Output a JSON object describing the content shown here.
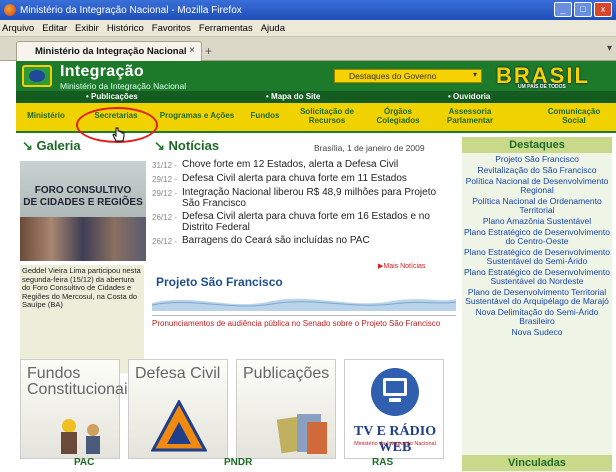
{
  "window": {
    "title": "Ministério da Integração Nacional - Mozilla Firefox"
  },
  "menu": [
    "Arquivo",
    "Editar",
    "Exibir",
    "Histórico",
    "Favoritos",
    "Ferramentas",
    "Ajuda"
  ],
  "tab": {
    "label": "Ministério da Integração Nacional",
    "close": "×",
    "new": "+"
  },
  "header": {
    "brand": "Integração",
    "subbrand": "Ministério da Integração Nacional",
    "dropdown": "Destaques do Governo",
    "dropdown_arrow": "▾",
    "brasil_main": "BRASIL",
    "brasil_tag": "UM PAÍS DE TODOS"
  },
  "utilbar": {
    "publicacoes": "• Publicações",
    "mapa": "• Mapa do Site",
    "ouvidoria": "• Ouvidoria"
  },
  "nav": [
    "Ministério",
    "Secretarias",
    "Programas e Ações",
    "Fundos",
    "Solicitação de Recursos",
    "Órgãos Colegiados",
    "Assessoria Parlamentar",
    "Comunicação Social"
  ],
  "galeria": {
    "title": "Galeria",
    "image_line1": "FORO CONSULTIVO",
    "image_line2": "DE CIDADES E REGIÕES",
    "caption": "Geddel Vieira Lima participou nesta segunda-feira (15/12) da abertura do Foro Consultivo de Cidades e Regiões do Mercosul, na Costa do Sauípe (BA)"
  },
  "noticias": {
    "title": "Notícias",
    "date": "Brasília, 1 de janeiro de 2009",
    "items": [
      {
        "date": "31/12 -",
        "text": "Chove forte em 12 Estados, alerta a Defesa Civil"
      },
      {
        "date": "29/12 -",
        "text": "Defesa Civil alerta para chuva forte em 11 Estados"
      },
      {
        "date": "29/12 -",
        "text": "Integração Nacional liberou R$ 48,9 milhões para Projeto São Francisco"
      },
      {
        "date": "26/12 -",
        "text": "Defesa Civil alerta para chuva forte em 16 Estados e no Distrito Federal"
      },
      {
        "date": "26/12 -",
        "text": "Barragens do Ceará são incluídas no PAC"
      }
    ],
    "more": "▶Mais Notícias"
  },
  "projeto": {
    "title": "Projeto São Francisco"
  },
  "pronunciamentos": "Pronunciamentos de audiência pública no Senado sobre o Projeto São Francisco",
  "tiles": [
    "Fundos Constitucionais",
    "Defesa Civil",
    "Publicações",
    "TV E RÁDIO WEB"
  ],
  "tv_sub": "Ministério da Integração Nacional",
  "bottom": [
    "PAC",
    "PNDR",
    "RAS"
  ],
  "destaques": {
    "title": "Destaques",
    "items": [
      "Projeto São Francisco",
      "Revitalização do São Francisco",
      "Política Nacional de Desenvolvimento Regional",
      "Política Nacional de Ordenamento Territorial",
      "Plano Amazônia Sustentável",
      "Plano Estratégico de Desenvolvimento do Centro-Oeste",
      "Plano Estratégico de Desenvolvimento Sustentável do Semi-Árido",
      "Plano Estratégico de Desenvolvimento Sustentável do Nordeste",
      "Plano de Desenvolvimento Territorial Sustentável do Arquipélago de Marajó",
      "Nova Delimitação do Semi-Árido Brasileiro",
      "Nova Sudeco"
    ],
    "vinculadas": "Vinculadas"
  },
  "colors": {
    "green": "#1d7a2a",
    "yellow": "#f0d200",
    "link": "#1a46a8",
    "red": "#e02020"
  }
}
